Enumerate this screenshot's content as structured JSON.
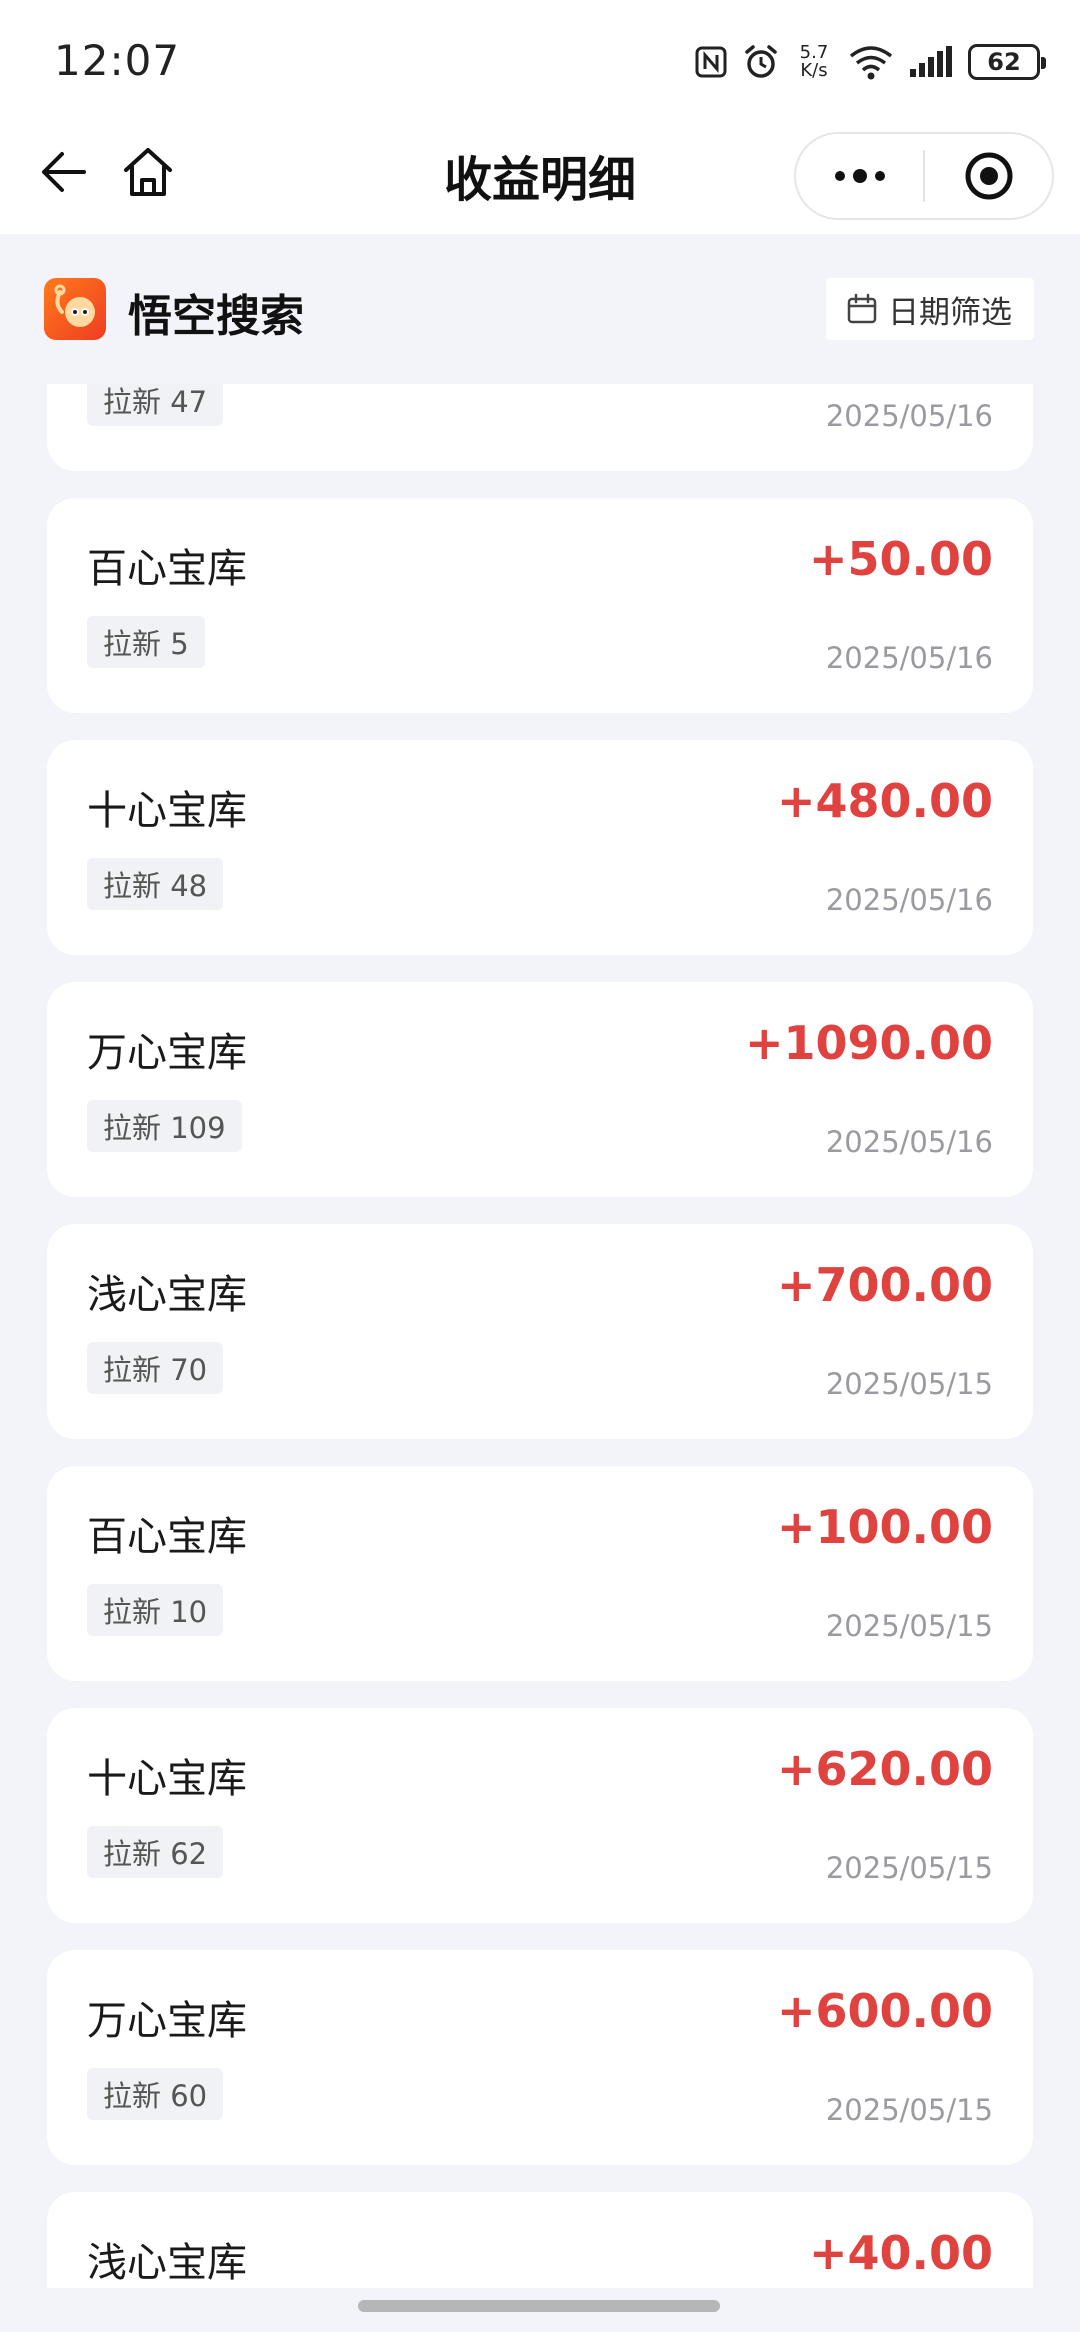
{
  "status_bar": {
    "time": "12:07",
    "net_speed_value": "5.7",
    "net_speed_unit": "K/s",
    "battery": "62"
  },
  "nav": {
    "title": "收益明细"
  },
  "app": {
    "name": "悟空搜索",
    "date_filter_label": "日期筛选"
  },
  "records": [
    {
      "name": "",
      "amount": "",
      "tag": "拉新 47",
      "date": "2025/05/16"
    },
    {
      "name": "百心宝库",
      "amount": "+50.00",
      "tag": "拉新 5",
      "date": "2025/05/16"
    },
    {
      "name": "十心宝库",
      "amount": "+480.00",
      "tag": "拉新 48",
      "date": "2025/05/16"
    },
    {
      "name": "万心宝库",
      "amount": "+1090.00",
      "tag": "拉新 109",
      "date": "2025/05/16"
    },
    {
      "name": "浅心宝库",
      "amount": "+700.00",
      "tag": "拉新 70",
      "date": "2025/05/15"
    },
    {
      "name": "百心宝库",
      "amount": "+100.00",
      "tag": "拉新 10",
      "date": "2025/05/15"
    },
    {
      "name": "十心宝库",
      "amount": "+620.00",
      "tag": "拉新 62",
      "date": "2025/05/15"
    },
    {
      "name": "万心宝库",
      "amount": "+600.00",
      "tag": "拉新 60",
      "date": "2025/05/15"
    },
    {
      "name": "浅心宝库",
      "amount": "+40.00",
      "tag": "",
      "date": ""
    }
  ],
  "colors": {
    "amount": "#e0433f",
    "background": "#f3f4f9",
    "card": "#ffffff"
  }
}
